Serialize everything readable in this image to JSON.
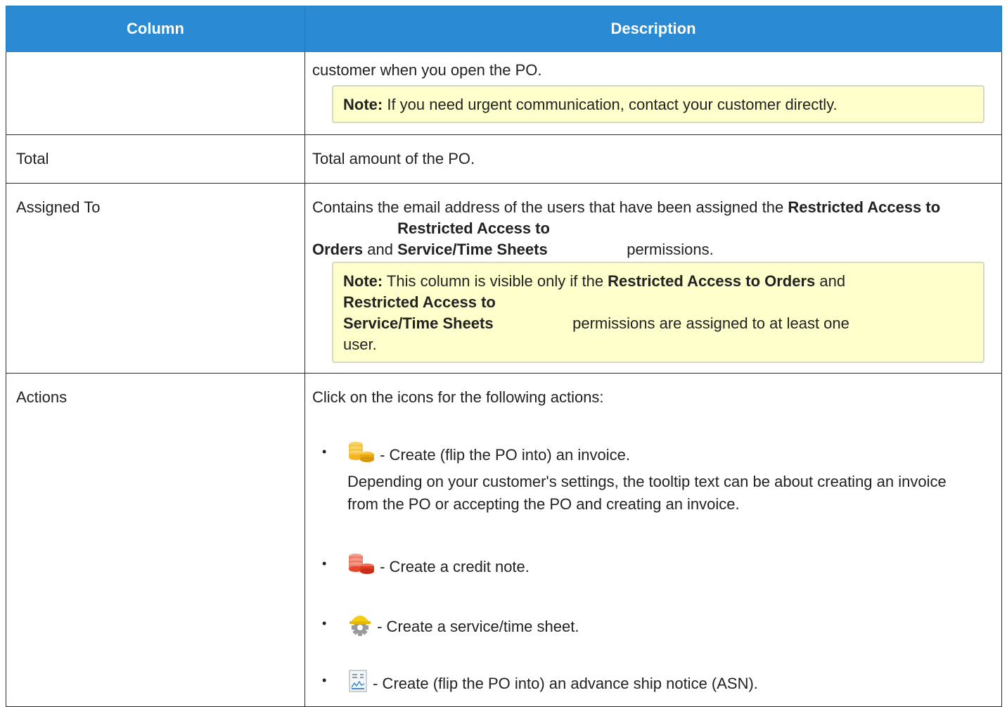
{
  "table": {
    "headers": [
      "Column",
      "Description"
    ],
    "rows": {
      "continuation": {
        "column": "",
        "text": "customer when you open the PO.",
        "note": {
          "label": "Note:",
          "text": " If you need urgent communication, contact your customer directly."
        }
      },
      "total": {
        "column": "Total",
        "text": "Total amount of the PO."
      },
      "assigned": {
        "column": "Assigned To",
        "t1": "Contains the email address of the users that have been assigned the ",
        "b1": "Restricted Access to Orders",
        "t2": " and ",
        "b2": "Restricted Access to Service/Time Sheets",
        "t3": " permissions.",
        "note": {
          "label": "Note:",
          "t1": " This column is visible only if the ",
          "b1": "Restricted Access to Orders",
          "t2": " and ",
          "b2": "Restricted Access to Service/Time Sheets",
          "t3": " permissions are assigned to at least one user."
        }
      },
      "actions": {
        "column": "Actions",
        "intro": "Click on the icons for the following actions:",
        "bullet": "•",
        "items": [
          {
            "icon": "invoice-coins-icon",
            "text": " - Create (flip the PO into) an invoice.",
            "detail": "Depending on your customer's settings, the tooltip text can be about creating an invoice from the PO or accepting the PO and creating an invoice."
          },
          {
            "icon": "credit-note-coins-icon",
            "text": " - Create a credit note."
          },
          {
            "icon": "service-sheet-hardhat-icon",
            "text": " - Create a service/time sheet."
          },
          {
            "icon": "asn-document-icon",
            "text": " - Create (flip the PO into) an advance ship notice (ASN)."
          }
        ]
      }
    }
  },
  "colors": {
    "header_bg": "#2a8ad3",
    "note_bg": "#ffffcc",
    "invoice_icon": "#f2b620",
    "credit_icon": "#e8452c",
    "hardhat_icon": "#f4cc10"
  }
}
